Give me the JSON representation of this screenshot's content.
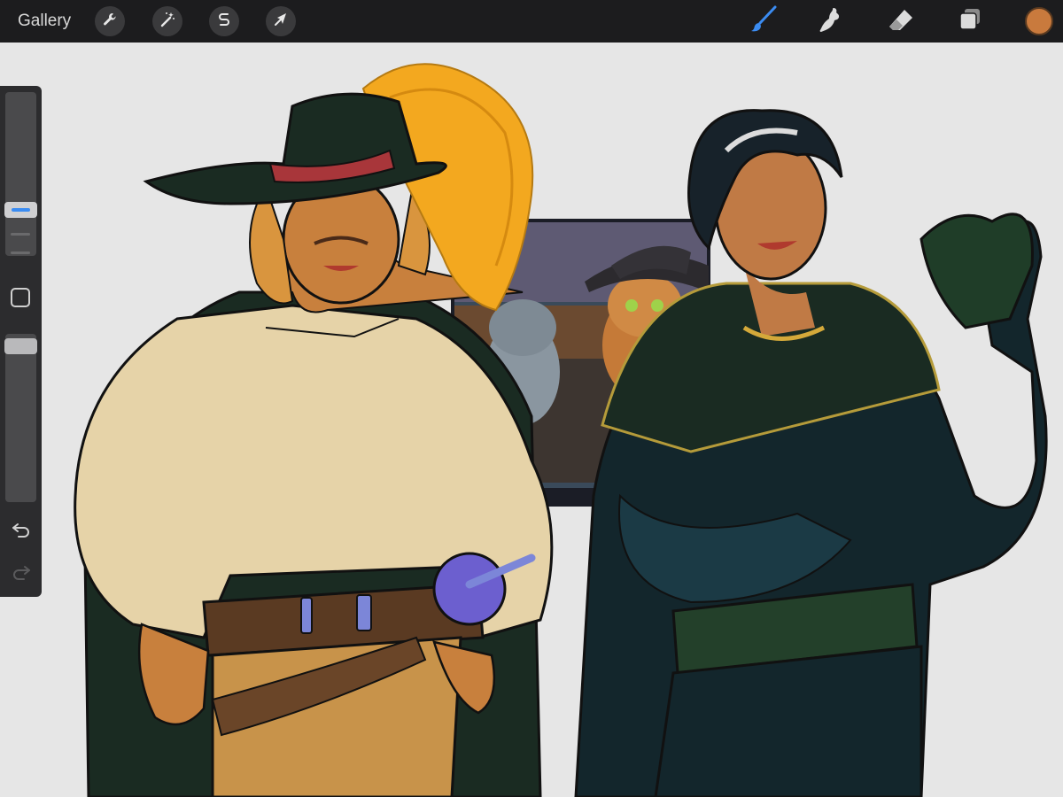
{
  "topbar": {
    "gallery_label": "Gallery",
    "left_tools": [
      "wrench-icon",
      "magic-wand-icon",
      "selection-s-icon",
      "transform-arrow-icon"
    ],
    "right_tools": [
      "brush-icon",
      "smudge-icon",
      "eraser-icon",
      "layers-icon"
    ],
    "active_tool": "brush-icon",
    "accent_color": "#3b8cf2",
    "current_color": "#c97a3d"
  },
  "sidebar": {
    "tools": [
      "brush-size-slider",
      "modify-button",
      "opacity-slider",
      "undo-icon",
      "redo-icon"
    ],
    "brush_size_level": 0.5,
    "opacity_level": 0.95
  },
  "canvas": {
    "background_color": "#e6e6e6",
    "artwork": "two-character-illustration-with-reference-image"
  }
}
